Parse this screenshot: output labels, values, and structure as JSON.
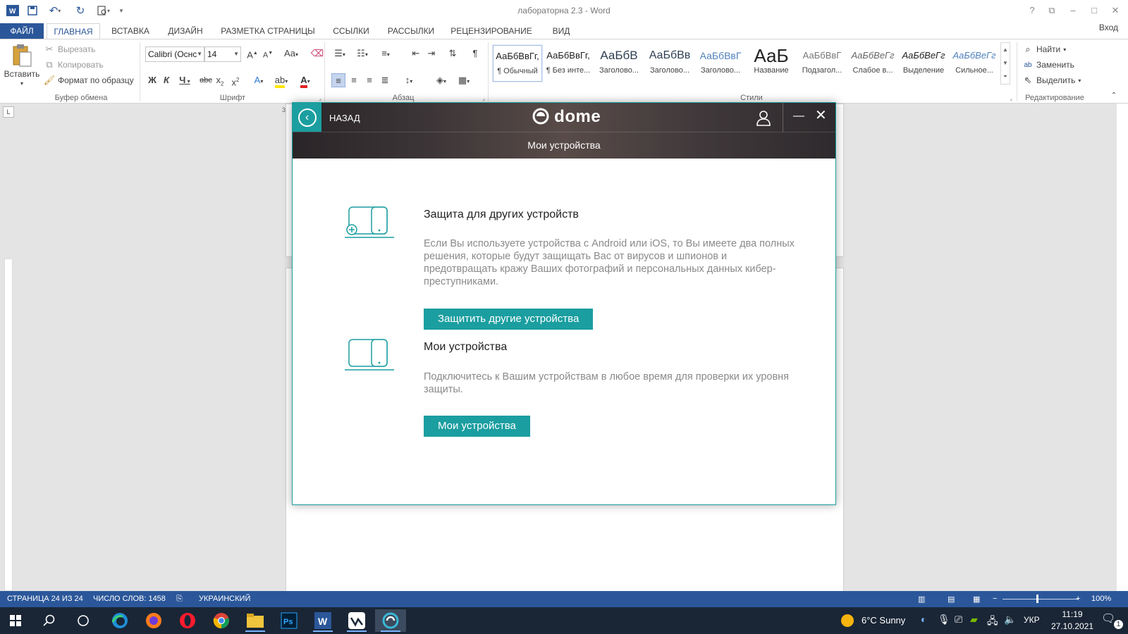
{
  "window": {
    "title": "лабораторна 2.3 - Word",
    "controls": [
      "?",
      "⧉",
      "–",
      "□",
      "✕"
    ]
  },
  "qat": {
    "icons": [
      "word-icon",
      "save-icon",
      "undo-icon",
      "redo-icon",
      "print-preview-icon",
      "customize-icon"
    ]
  },
  "tabs": [
    {
      "label": "ФАЙЛ"
    },
    {
      "label": "ГЛАВНАЯ"
    },
    {
      "label": "ВСТАВКА"
    },
    {
      "label": "ДИЗАЙН"
    },
    {
      "label": "РАЗМЕТКА СТРАНИЦЫ"
    },
    {
      "label": "ССЫЛКИ"
    },
    {
      "label": "РАССЫЛКИ"
    },
    {
      "label": "РЕЦЕНЗИРОВАНИЕ"
    },
    {
      "label": "ВИД"
    }
  ],
  "signin": "Вход",
  "ribbon": {
    "clipboard": {
      "paste": "Вставить",
      "cut": "Вырезать",
      "copy": "Копировать",
      "format_painter": "Формат по образцу",
      "label": "Буфер обмена"
    },
    "font": {
      "name": "Calibri (Оснс",
      "size": "14",
      "label": "Шрифт",
      "change_case": "Аа"
    },
    "paragraph": {
      "label": "Абзац"
    },
    "styles": {
      "label": "Стили",
      "items": [
        {
          "preview": "АаБбВвГг,",
          "name": "¶ Обычный"
        },
        {
          "preview": "АаБбВвГг,",
          "name": "¶ Без инте..."
        },
        {
          "preview": "АаБбВ",
          "name": "Заголово..."
        },
        {
          "preview": "АаБбВв",
          "name": "Заголово..."
        },
        {
          "preview": "АаБбВвГ",
          "name": "Заголово..."
        },
        {
          "preview": "АаБ",
          "name": "Название"
        },
        {
          "preview": "АаБбВвГ",
          "name": "Подзагол..."
        },
        {
          "preview": "АаБбВеГг",
          "name": "Слабое в..."
        },
        {
          "preview": "АаБбВеГг",
          "name": "Выделение"
        },
        {
          "preview": "АаБбВеГг",
          "name": "Сильное..."
        }
      ]
    },
    "editing": {
      "find": "Найти",
      "replace": "Заменить",
      "select": "Выделить",
      "label": "Редактирование"
    }
  },
  "ruler": {
    "corner": "L",
    "marker": "3"
  },
  "statusbar": {
    "page": "СТРАНИЦА 24 ИЗ 24",
    "words": "ЧИСЛО СЛОВ: 1458",
    "language": "УКРАИНСКИЙ",
    "zoom": "100%"
  },
  "taskbar": {
    "apps": [
      "windows-start-icon",
      "search-icon",
      "task-view-icon",
      "edge-icon",
      "firefox-icon",
      "opera-icon",
      "chrome-icon",
      "file-explorer-icon",
      "photoshop-icon",
      "word-icon",
      "vpn-icon",
      "dome-icon"
    ],
    "weather": "6°C  Sunny",
    "lang": "УКР",
    "time": "11:19",
    "date": "27.10.2021",
    "notifications": "1"
  },
  "dome": {
    "back": "НАЗАД",
    "logo": "dome",
    "subtitle": "Мои устройства",
    "sections": [
      {
        "title": "Защита для других устройств",
        "text": "Если Вы используете устройства с Android или iOS, то Вы имеете два полных решения, которые будут защищать Вас от вирусов и шпионов и предотвращать кражу Ваших фотографий и персональных данных кибер-преступниками.",
        "button": "Защитить другие устройства"
      },
      {
        "title": "Мои устройства",
        "text": "Подключитесь к Вашим устройствам в любое время для проверки их уровня защиты.",
        "button": "Мои устройства"
      }
    ],
    "accent": "#1b9ea0"
  },
  "colors": {
    "word_blue": "#2b579a",
    "taskbar": "#1a2636"
  }
}
